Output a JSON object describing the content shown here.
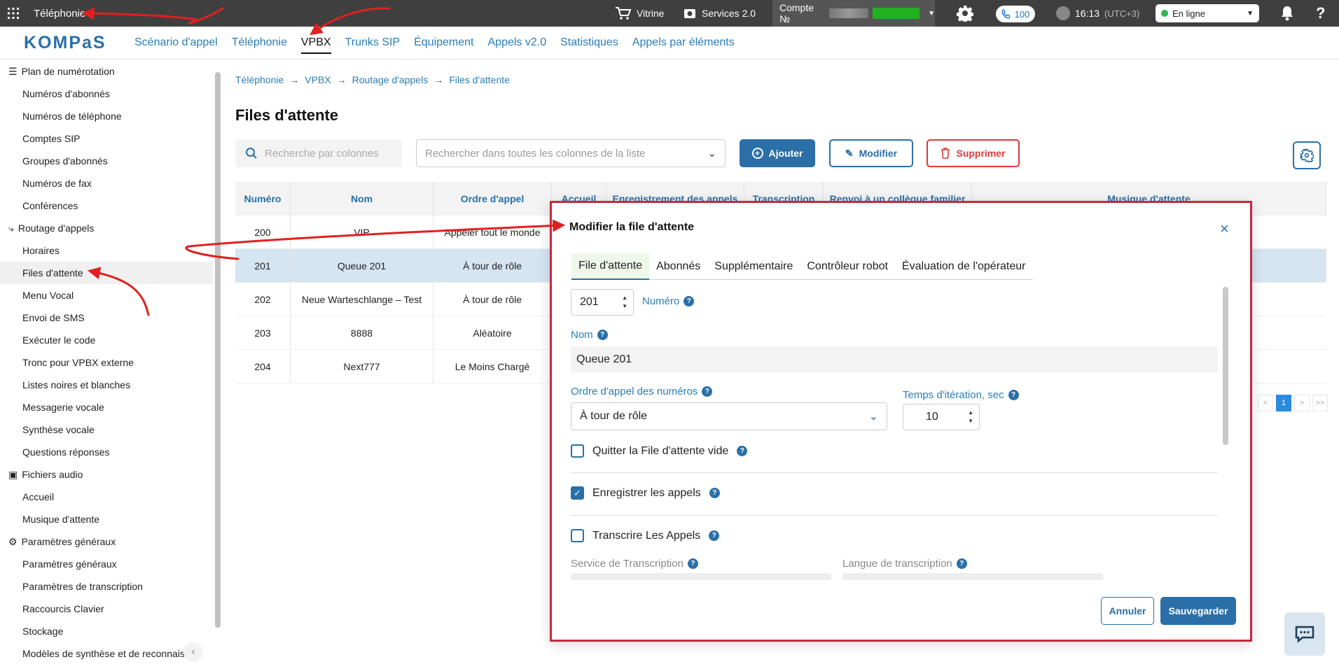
{
  "topbar": {
    "app_title": "Téléphonie",
    "showcase": "Vitrine",
    "services": "Services 2.0",
    "account_label": "Compte №",
    "calls_badge": "100",
    "time": "16:13",
    "timezone": "(UTC+3)",
    "status": "En ligne",
    "help": "?"
  },
  "nav": {
    "logo": "KOMPaS",
    "tabs": [
      {
        "label": "Scénario d'appel"
      },
      {
        "label": "Téléphonie"
      },
      {
        "label": "VPBX"
      },
      {
        "label": "Trunks SIP"
      },
      {
        "label": "Équipement"
      },
      {
        "label": "Appels v2.0"
      },
      {
        "label": "Statistiques"
      },
      {
        "label": "Appels par éléments"
      }
    ]
  },
  "sidebar": {
    "groups": [
      {
        "label": "Plan de numérotation",
        "icon": "list-icon",
        "items": [
          "Numéros d'abonnés",
          "Numéros de téléphone",
          "Comptes SIP",
          "Groupes d'abonnés",
          "Numéros de fax",
          "Conférences"
        ]
      },
      {
        "label": "Routage d'appels",
        "icon": "routing-icon",
        "items": [
          "Horaires",
          "Files d'attente",
          "Menu Vocal",
          "Envoi de SMS",
          "Exécuter le code",
          "Tronc pour VPBX externe",
          "Listes noires et blanches",
          "Messagerie vocale",
          "Synthèse vocale",
          "Questions réponses"
        ]
      },
      {
        "label": "Fichiers audio",
        "icon": "audio-file-icon",
        "items": [
          "Accueil",
          "Musique d'attente"
        ]
      },
      {
        "label": "Paramètres généraux",
        "icon": "gear-icon",
        "items": [
          "Paramètres généraux",
          "Paramètres de transcription",
          "Raccourcis Clavier",
          "Stockage",
          "Modèles de synthèse et de reconnais"
        ]
      }
    ],
    "active_item": "Files d'attente"
  },
  "breadcrumb": [
    "Téléphonie",
    "VPBX",
    "Routage d'appels",
    "Files d'attente"
  ],
  "page": {
    "title": "Files d'attente",
    "search_columns_placeholder": "Recherche par colonnes",
    "search_all_placeholder": "Rechercher dans toutes les colonnes de la liste",
    "add": "Ajouter",
    "edit": "Modifier",
    "delete": "Supprimer"
  },
  "table": {
    "columns": [
      "Numéro",
      "Nom",
      "Ordre d'appel",
      "Accueil",
      "Enregistrement des appels",
      "Transcription",
      "Renvoi à un collègue familier",
      "Musique d'attente"
    ],
    "rows": [
      {
        "num": "200",
        "name": "VIP",
        "order": "Appeler tout le monde"
      },
      {
        "num": "201",
        "name": "Queue 201",
        "order": "À tour de rôle"
      },
      {
        "num": "202",
        "name": "Neue Warteschlange – Test",
        "order": "À tour de rôle"
      },
      {
        "num": "203",
        "name": "8888",
        "order": "Aléatoire"
      },
      {
        "num": "204",
        "name": "Next777",
        "order": "Le Moins Chargé"
      }
    ]
  },
  "pager": {
    "prev": "<",
    "first": "<",
    "current": "1",
    "next": ">",
    "last": ">>"
  },
  "modal": {
    "title": "Modifier la file d'attente",
    "close": "×",
    "tabs": [
      "File d'attente",
      "Abonnés",
      "Supplémentaire",
      "Contrôleur robot",
      "Évaluation de l'opérateur"
    ],
    "number_value": "201",
    "number_label": "Numéro",
    "name_label": "Nom",
    "name_value": "Queue 201",
    "order_label": "Ordre d'appel des numéros",
    "order_value": "À tour de rôle",
    "iteration_label": "Temps d'itération, sec",
    "iteration_value": "10",
    "leave_empty": "Quitter la File d'attente vide",
    "record_calls": "Enregistrer les appels",
    "transcribe": "Transcrire Les Appels",
    "transcription_service": "Service de Transcription",
    "transcription_language": "Langue de transcription",
    "cancel": "Annuler",
    "save": "Sauvegarder",
    "checks": {
      "leave_empty": false,
      "record_calls": true,
      "transcribe": false
    }
  },
  "colors": {
    "accent": "#2a6fa8",
    "danger": "#d93a3a",
    "annotation": "#e02020",
    "modal_border": "#c8283c"
  }
}
